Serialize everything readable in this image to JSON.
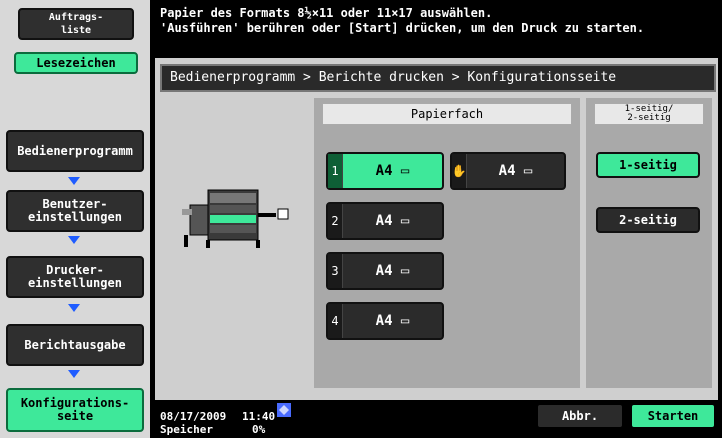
{
  "sidebar": {
    "job_list": "Auftrags-\nliste",
    "bookmarks": "Lesezeichen",
    "steps": [
      "Bedienerprogramm",
      "Benutzer-\neinstellungen",
      "Drucker-\neinstellungen",
      "Berichtausgabe",
      "Konfigurations-\nseite"
    ]
  },
  "message": {
    "line1": "Papier des Formats 8½×11 oder 11×17 auswählen.",
    "line2": "'Ausführen' berühren oder [Start] drücken, um den Druck zu starten."
  },
  "breadcrumb": "Bedienerprogramm > Berichte drucken > Konfigurationsseite",
  "paper_tray": {
    "header": "Papierfach",
    "trays": [
      {
        "num": "1",
        "label": "A4 ▭",
        "selected": true
      },
      {
        "num": "✋",
        "label": "A4 ▭",
        "selected": false
      },
      {
        "num": "2",
        "label": "A4 ▭",
        "selected": false
      },
      {
        "num": "3",
        "label": "A4 ▭",
        "selected": false
      },
      {
        "num": "4",
        "label": "A4 ▭",
        "selected": false
      }
    ]
  },
  "sides": {
    "header": "1-seitig/\n2-seitig",
    "one": "1-seitig",
    "two": "2-seitig"
  },
  "status": {
    "date": "08/17/2009",
    "time": "11:40",
    "memory_label": "Speicher",
    "memory_value": "0%"
  },
  "footer": {
    "cancel": "Abbr.",
    "start": "Starten"
  }
}
